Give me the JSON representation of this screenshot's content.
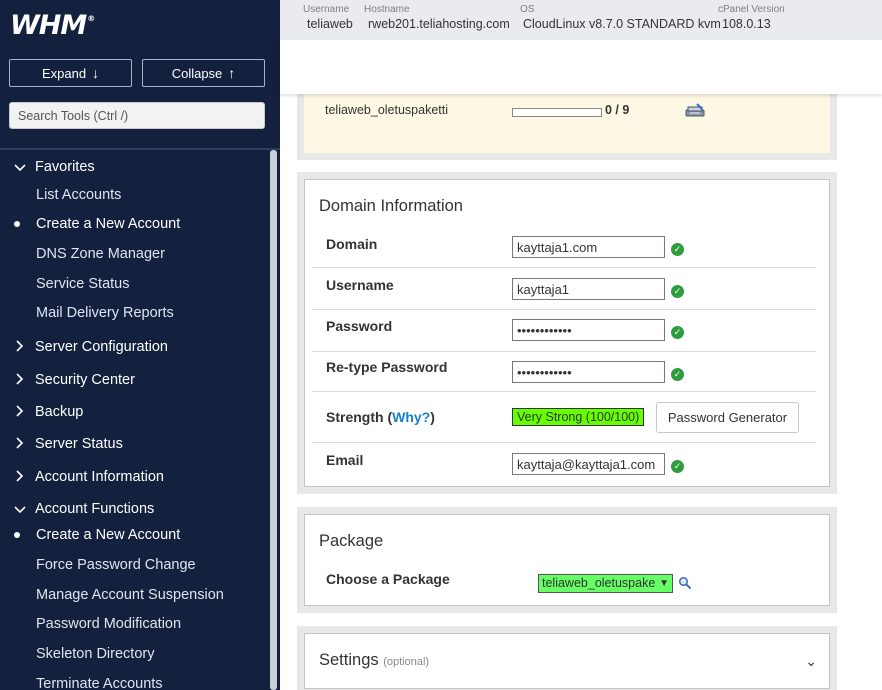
{
  "sidebar": {
    "logo": "WHM",
    "logo_tm": "®",
    "expand_label": "Expand",
    "collapse_label": "Collapse",
    "search_placeholder": "Search Tools (Ctrl /)",
    "nav": [
      {
        "kind": "category",
        "label": "Favorites",
        "expanded": true
      },
      {
        "kind": "item",
        "label": "List Accounts",
        "active": false
      },
      {
        "kind": "item",
        "label": "Create a New Account",
        "active": true
      },
      {
        "kind": "item",
        "label": "DNS Zone Manager",
        "active": false
      },
      {
        "kind": "item",
        "label": "Service Status",
        "active": false
      },
      {
        "kind": "item",
        "label": "Mail Delivery Reports",
        "active": false
      },
      {
        "kind": "category",
        "label": "Server Configuration",
        "expanded": false
      },
      {
        "kind": "category",
        "label": "Security Center",
        "expanded": false
      },
      {
        "kind": "category",
        "label": "Backup",
        "expanded": false
      },
      {
        "kind": "category",
        "label": "Server Status",
        "expanded": false
      },
      {
        "kind": "category",
        "label": "Account Information",
        "expanded": false
      },
      {
        "kind": "category",
        "label": "Account Functions",
        "expanded": true
      },
      {
        "kind": "item",
        "label": "Create a New Account",
        "active": true
      },
      {
        "kind": "item",
        "label": "Force Password Change",
        "active": false
      },
      {
        "kind": "item",
        "label": "Manage Account Suspension",
        "active": false
      },
      {
        "kind": "item",
        "label": "Password Modification",
        "active": false
      },
      {
        "kind": "item",
        "label": "Skeleton Directory",
        "active": false
      },
      {
        "kind": "item",
        "label": "Terminate Accounts",
        "active": false
      }
    ]
  },
  "header": {
    "username_label": "Username",
    "username_value": "teliaweb",
    "hostname_label": "Hostname",
    "hostname_value": "rweb201.teliahosting.com",
    "os_label": "OS",
    "os_value": "CloudLinux v8.7.0 STANDARD kvm",
    "cpanel_label": "cPanel Version",
    "cpanel_value": "108.0.13"
  },
  "package_summary": {
    "name": "teliaweb_oletuspaketti",
    "count": "0 / 9",
    "usage_fraction": 0
  },
  "domain_info": {
    "title": "Domain Information",
    "domain_label": "Domain",
    "domain_value": "kayttaja1.com",
    "username_label": "Username",
    "username_value": "kayttaja1",
    "password_label": "Password",
    "password_value": "••••••••••••",
    "retype_label": "Re-type Password",
    "retype_value": "••••••••••••",
    "strength_label": "Strength (",
    "strength_link": "Why?",
    "strength_close": ")",
    "strength_value": "Very Strong (100/100)",
    "pwgen_label": "Password Generator",
    "email_label": "Email",
    "email_value": "kayttaja@kayttaja1.com"
  },
  "package": {
    "title": "Package",
    "choose_label": "Choose a Package",
    "selected": "teliaweb_oletuspaketti"
  },
  "settings": {
    "title": "Settings",
    "optional": "(optional)"
  },
  "colors": {
    "sidebar_bg": "#13213f",
    "strength_bg": "#66ff00",
    "package_select_bg": "#66ff66",
    "check_green": "#2e9d3e",
    "link_blue": "#1a7fc4"
  }
}
